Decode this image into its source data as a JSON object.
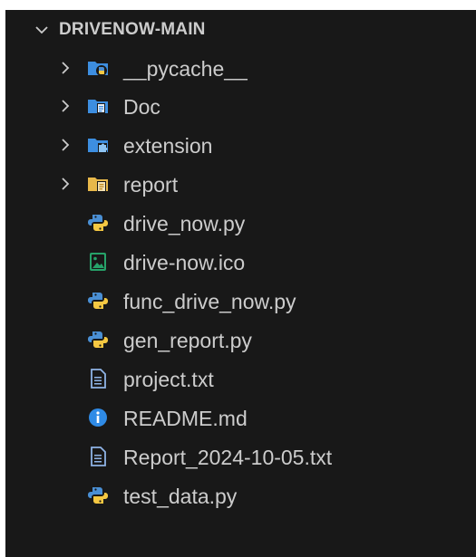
{
  "explorer": {
    "root_label": "DRIVENOW-MAIN",
    "items": [
      {
        "label": "__pycache__",
        "icon": "python-folder-icon",
        "kind": "folder"
      },
      {
        "label": "Doc",
        "icon": "doc-folder-icon",
        "kind": "folder"
      },
      {
        "label": "extension",
        "icon": "extension-folder-icon",
        "kind": "folder"
      },
      {
        "label": "report",
        "icon": "report-folder-icon",
        "kind": "folder"
      },
      {
        "label": "drive_now.py",
        "icon": "python-file-icon",
        "kind": "file"
      },
      {
        "label": "drive-now.ico",
        "icon": "image-file-icon",
        "kind": "file"
      },
      {
        "label": "func_drive_now.py",
        "icon": "python-file-icon",
        "kind": "file"
      },
      {
        "label": "gen_report.py",
        "icon": "python-file-icon",
        "kind": "file"
      },
      {
        "label": "project.txt",
        "icon": "text-file-icon",
        "kind": "file"
      },
      {
        "label": "README.md",
        "icon": "info-icon",
        "kind": "file"
      },
      {
        "label": "Report_2024-10-05.txt",
        "icon": "text-file-icon",
        "kind": "file"
      },
      {
        "label": "test_data.py",
        "icon": "python-file-icon",
        "kind": "file"
      }
    ]
  },
  "colors": {
    "background": "#181818",
    "text": "#cccccc",
    "folder_blue": "#3d8ee0",
    "folder_yellow": "#e8b84a",
    "python_blue": "#4a8fd4",
    "python_yellow": "#f5c842",
    "image_green": "#26a269",
    "info_blue": "#2f8be6"
  }
}
